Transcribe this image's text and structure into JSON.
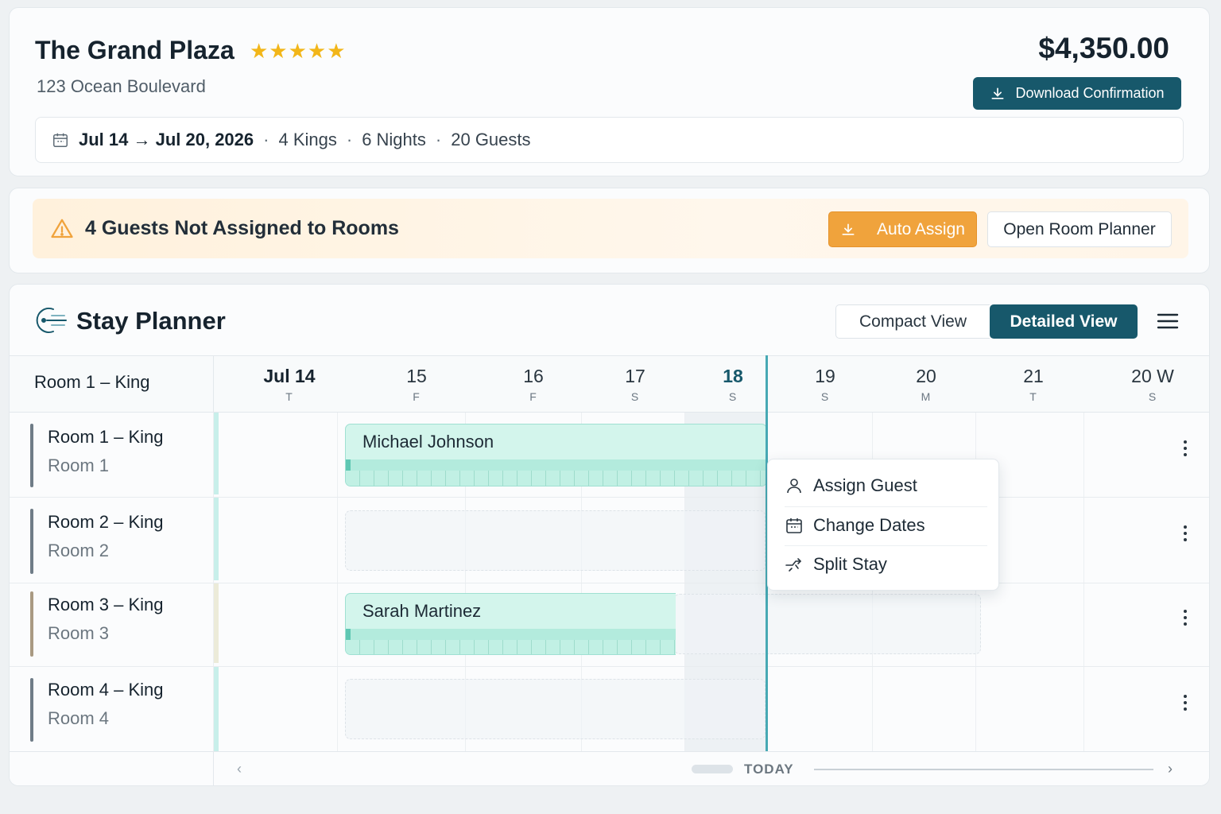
{
  "hotel": {
    "name": "The Grand Plaza",
    "stars": "★★★★★",
    "address": "123 Ocean Boulevard",
    "price": "$4,350.00",
    "download_label": "Download Confirmation"
  },
  "summary": {
    "dates": "Jul 14 → Jul 20, 2026",
    "rooms": "4 Kings",
    "nights": "6 Nights",
    "guests": "20 Guests",
    "separator": "·"
  },
  "alert": {
    "text": "4 Guests Not Assigned to Rooms",
    "auto_assign_label": "Auto Assign",
    "open_planner_label": "Open Room Planner"
  },
  "planner": {
    "title": "Stay Planner",
    "compact_label": "Compact View",
    "detailed_label": "Detailed View",
    "active_view": "Detailed View",
    "header_room": "Room 1 – King",
    "days": [
      {
        "date": "Jul 14",
        "weekday": "T"
      },
      {
        "date": "15",
        "weekday": "F"
      },
      {
        "date": "16",
        "weekday": "F"
      },
      {
        "date": "17",
        "weekday": "S"
      },
      {
        "date": "18",
        "weekday": "S"
      },
      {
        "date": "19",
        "weekday": "S"
      },
      {
        "date": "20",
        "weekday": "M"
      },
      {
        "date": "21",
        "weekday": "T"
      },
      {
        "date": "20  W",
        "weekday": "S"
      }
    ],
    "rooms": [
      {
        "title": "Room 1 – King",
        "subtitle": "Room 1"
      },
      {
        "title": "Room 2 – King",
        "subtitle": "Room 2"
      },
      {
        "title": "Room 3 – King",
        "subtitle": "Room 3"
      },
      {
        "title": "Room 4 – King",
        "subtitle": "Room 4"
      }
    ],
    "bookings": [
      {
        "guest": "Michael Johnson",
        "room": "Room 1 – King"
      },
      {
        "guest": "Sarah Martinez",
        "room": "Room 3 – King"
      }
    ],
    "context_menu": {
      "assign": "Assign Guest",
      "change_dates": "Change Dates",
      "split": "Split Stay"
    },
    "footer": {
      "today_label": "TODAY",
      "prev": "‹",
      "next": "›"
    }
  },
  "colors": {
    "primary": "#17586b",
    "accent_orange": "#f0a33c",
    "star": "#f2b619",
    "booking_fill": "#d3f5ec",
    "today_line": "#47a9b4"
  }
}
